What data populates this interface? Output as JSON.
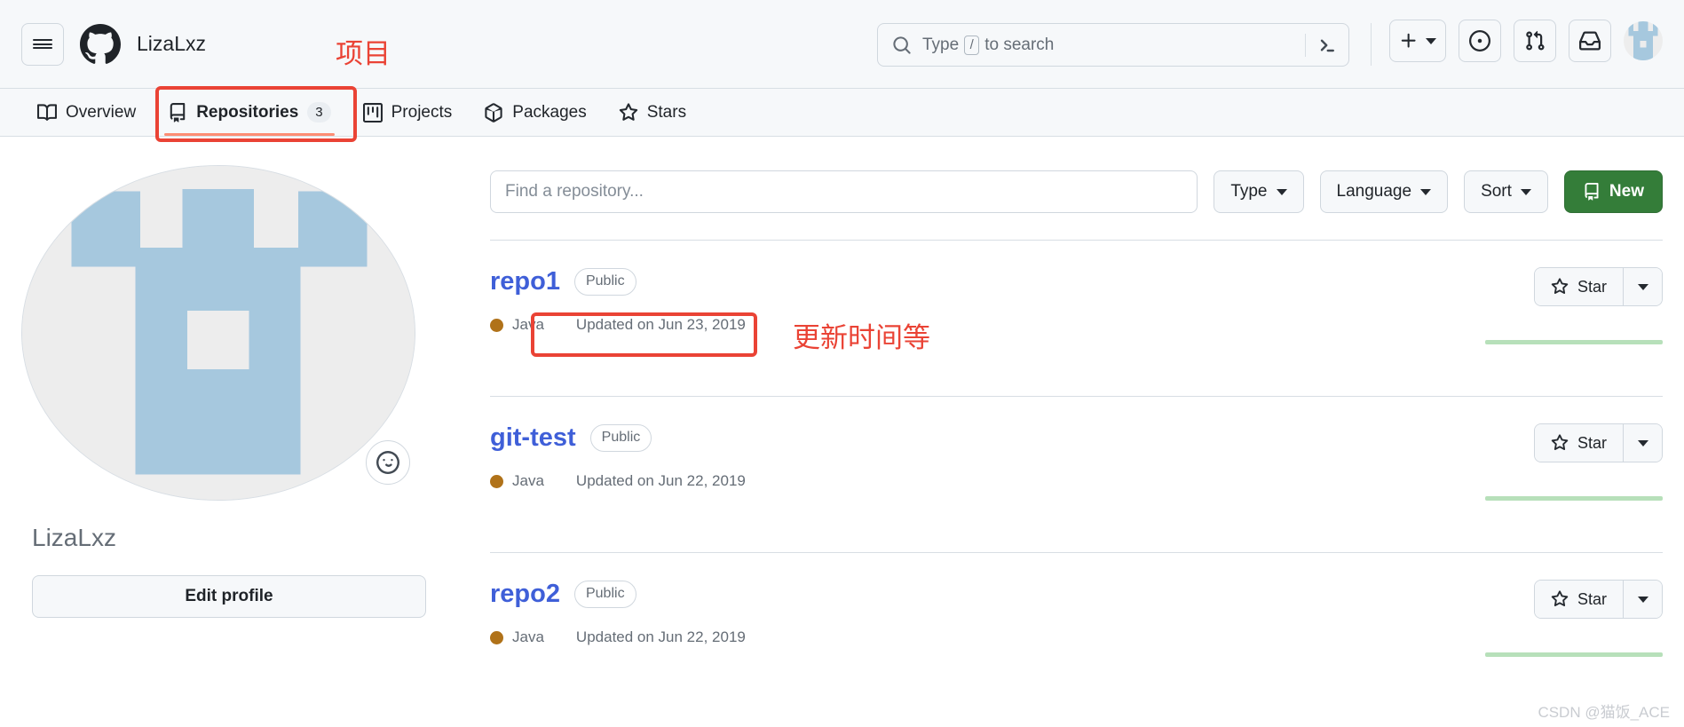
{
  "header": {
    "menu_icon": "hamburger-icon",
    "logo_icon": "github-logo-icon",
    "owner": "LizaLxz",
    "search": {
      "icon": "search-icon",
      "placeholder_prefix": "Type",
      "slash_key": "/",
      "placeholder_suffix": "to search",
      "command_icon": "terminal-icon"
    },
    "actions": [
      {
        "name": "create-new-button",
        "icon": "plus-icon",
        "has_caret": true
      },
      {
        "name": "issues-button",
        "icon": "issue-opened-icon",
        "has_caret": false
      },
      {
        "name": "pull-requests-button",
        "icon": "git-pull-request-icon",
        "has_caret": false
      },
      {
        "name": "notifications-button",
        "icon": "inbox-icon",
        "has_caret": false
      }
    ],
    "avatar_name": "user-avatar"
  },
  "nav": {
    "tabs": [
      {
        "label": "Overview",
        "icon": "book-icon",
        "count": "",
        "active": false
      },
      {
        "label": "Repositories",
        "icon": "repo-icon",
        "count": "3",
        "active": true
      },
      {
        "label": "Projects",
        "icon": "project-table-icon",
        "count": "",
        "active": false
      },
      {
        "label": "Packages",
        "icon": "package-cube-icon",
        "count": "",
        "active": false
      },
      {
        "label": "Stars",
        "icon": "star-icon",
        "count": "",
        "active": false
      }
    ]
  },
  "sidebar": {
    "avatar_name": "profile-avatar",
    "avatar_colors": {
      "base": "#ededed",
      "pattern": "#a6c8de"
    },
    "status_emoji": "smiley-icon",
    "username": "LizaLxz",
    "edit_profile_label": "Edit profile"
  },
  "main": {
    "find_placeholder": "Find a repository...",
    "filters": [
      {
        "label": "Type",
        "name": "type-filter"
      },
      {
        "label": "Language",
        "name": "language-filter"
      },
      {
        "label": "Sort",
        "name": "sort-filter"
      }
    ],
    "new_button": {
      "label": "New",
      "icon": "repo-icon",
      "color": "#347d39"
    },
    "star_label": "Star",
    "repos": [
      {
        "name": "repo1",
        "visibility": "Public",
        "language": "Java",
        "language_color": "#b07219",
        "updated": "Updated on Jun 23, 2019"
      },
      {
        "name": "git-test",
        "visibility": "Public",
        "language": "Java",
        "language_color": "#b07219",
        "updated": "Updated on Jun 22, 2019"
      },
      {
        "name": "repo2",
        "visibility": "Public",
        "language": "Java",
        "language_color": "#b07219",
        "updated": "Updated on Jun 22, 2019"
      }
    ]
  },
  "annotations": {
    "color": "#ea4335",
    "project_label": "项目",
    "updated_label": "更新时间等"
  },
  "watermark": "CSDN @猫饭_ACE"
}
